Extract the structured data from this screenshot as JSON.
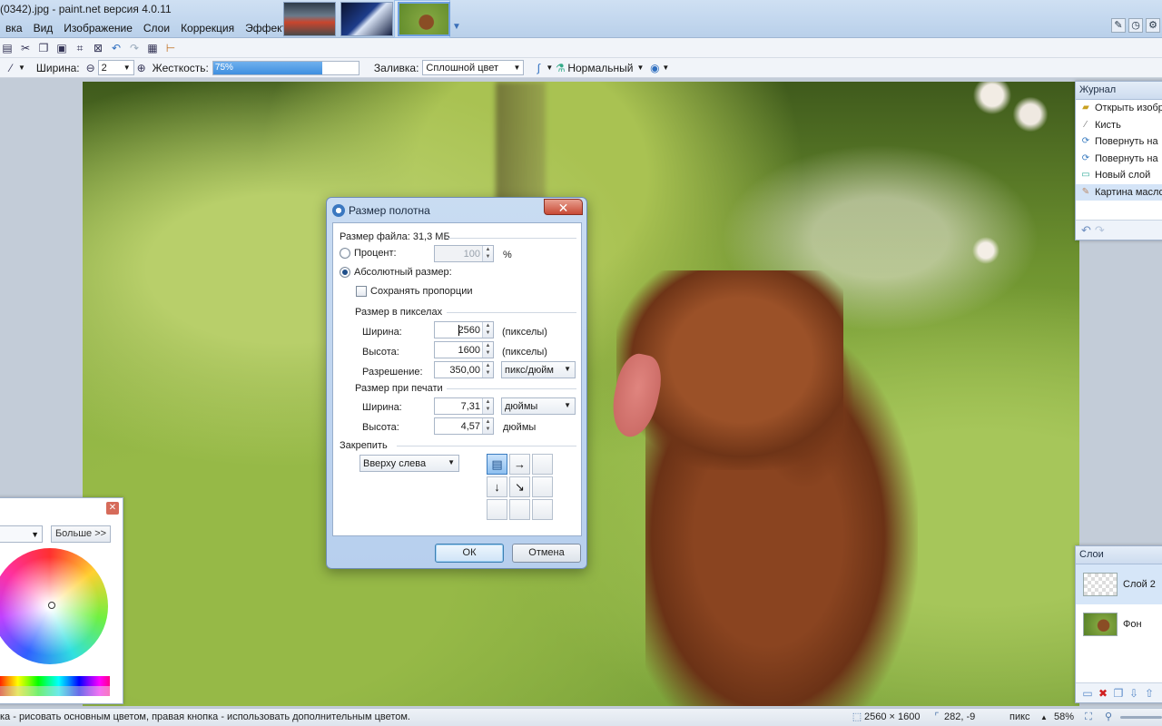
{
  "window": {
    "title": "(0342).jpg - paint.net версия 4.0.11"
  },
  "menu": [
    "вка",
    "Вид",
    "Изображение",
    "Слои",
    "Коррекция",
    "Эффекты"
  ],
  "toolbar2": {
    "width_label": "Ширина:",
    "width_value": "2",
    "hardness_label": "Жесткость:",
    "hardness_value": "75%",
    "hardness_fraction": 0.75,
    "fill_label": "Заливка:",
    "fill_value": "Сплошной цвет",
    "blend_mode": "Нормальный"
  },
  "history": {
    "title": "Журнал",
    "items": [
      {
        "label": "Открыть изобр",
        "icon": "open-folder-icon"
      },
      {
        "label": "Кисть",
        "icon": "brush-icon"
      },
      {
        "label": "Повернуть на",
        "icon": "rotate-icon"
      },
      {
        "label": "Повернуть на",
        "icon": "rotate-icon"
      },
      {
        "label": "Новый слой",
        "icon": "new-layer-icon"
      },
      {
        "label": "Картина масло",
        "icon": "oil-painting-icon"
      }
    ]
  },
  "layers": {
    "title": "Слои",
    "items": [
      {
        "label": "Слой 2"
      },
      {
        "label": "Фон"
      }
    ]
  },
  "colors": {
    "more_button": "Больше >>"
  },
  "dialog": {
    "title": "Размер полотна",
    "file_size": "Размер файла: 31,3 МБ",
    "percent_label": "Процент:",
    "percent_value": "100",
    "percent_unit": "%",
    "absolute_label": "Абсолютный размер:",
    "keep_ratio_label": "Сохранять пропорции",
    "pixel_size_heading": "Размер в пикселах",
    "px_width_label": "Ширина:",
    "px_width_value": "2560",
    "px_width_unit": "(пикселы)",
    "px_height_label": "Высота:",
    "px_height_value": "1600",
    "px_height_unit": "(пикселы)",
    "resolution_label": "Разрешение:",
    "resolution_value": "350,00",
    "resolution_unit": "пикс/дюйм",
    "print_size_heading": "Размер при печати",
    "print_width_label": "Ширина:",
    "print_width_value": "7,31",
    "print_width_unit": "дюймы",
    "print_height_label": "Высота:",
    "print_height_value": "4,57",
    "print_height_unit": "дюймы",
    "anchor_heading": "Закрепить",
    "anchor_value": "Вверху слева",
    "ok_label": "ОК",
    "cancel_label": "Отмена"
  },
  "status": {
    "hint": "ка - рисовать основным цветом, правая кнопка - использовать дополнительным цветом.",
    "image_size": "2560 × 1600",
    "cursor_pos": "282, -9",
    "unit": "пикс",
    "zoom": "58%"
  }
}
